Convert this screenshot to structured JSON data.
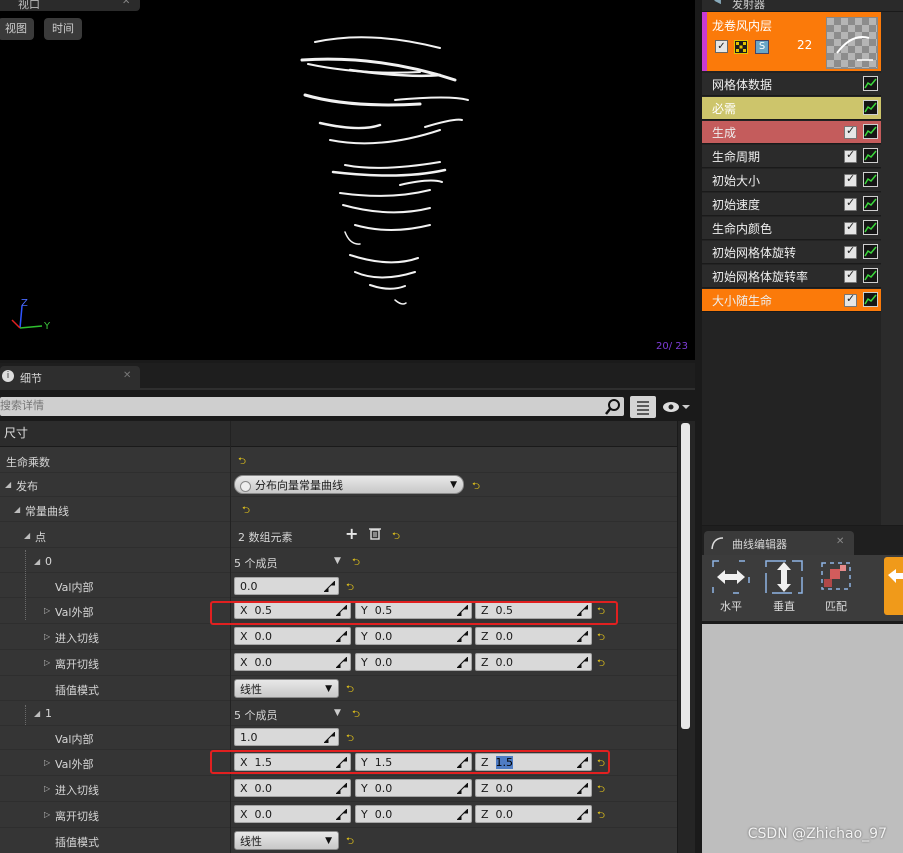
{
  "viewport": {
    "tab_label": "视口",
    "btn_view": "视图",
    "btn_time": "时间",
    "axis_z": "Z",
    "axis_y": "Y",
    "counter": "20/ 23"
  },
  "details": {
    "tab_label": "细节",
    "search_placeholder": "搜索详情",
    "section": "尺寸",
    "rows": {
      "life_mult": "生命乘数",
      "dist": "发布",
      "dist_value": "分布向量常量曲线",
      "const_curve": "常量曲线",
      "points": "点",
      "points_value": "2 数组元素",
      "idx0": "0",
      "idx0_value": "5 个成员",
      "in_val": "Val内部",
      "out_val": "Val外部",
      "arrive_tangent": "进入切线",
      "leave_tangent": "离开切线",
      "interp_mode": "插值模式",
      "interp_value": "线性",
      "idx1": "1",
      "idx1_value": "5 个成员"
    },
    "p0": {
      "in_val": "0.0",
      "out": {
        "x": "0.5",
        "y": "0.5",
        "z": "0.5"
      },
      "arrive": {
        "x": "0.0",
        "y": "0.0",
        "z": "0.0"
      },
      "leave": {
        "x": "0.0",
        "y": "0.0",
        "z": "0.0"
      }
    },
    "p1": {
      "in_val": "1.0",
      "out": {
        "x": "1.5",
        "y": "1.5",
        "z": "1.5"
      },
      "arrive": {
        "x": "0.0",
        "y": "0.0",
        "z": "0.0"
      },
      "leave": {
        "x": "0.0",
        "y": "0.0",
        "z": "0.0"
      }
    },
    "axis_labels": {
      "x": "X",
      "y": "Y",
      "z": "Z"
    }
  },
  "emitter": {
    "tab_label": "发射器",
    "name": "龙卷风内层",
    "count": "22",
    "modules": [
      {
        "label": "网格体数据",
        "color": "#2b2b2b",
        "checkbox": false
      },
      {
        "label": "必需",
        "color": "#cdc56b",
        "checkbox": false
      },
      {
        "label": "生成",
        "color": "#c45c5c",
        "checkbox": true
      },
      {
        "label": "生命周期",
        "color": "#2b2b2b",
        "checkbox": true
      },
      {
        "label": "初始大小",
        "color": "#2b2b2b",
        "checkbox": true
      },
      {
        "label": "初始速度",
        "color": "#2b2b2b",
        "checkbox": true
      },
      {
        "label": "生命内颜色",
        "color": "#2b2b2b",
        "checkbox": true
      },
      {
        "label": "初始网格体旋转",
        "color": "#2b2b2b",
        "checkbox": true
      },
      {
        "label": "初始网格体旋转率",
        "color": "#2b2b2b",
        "checkbox": true
      },
      {
        "label": "大小随生命",
        "color": "#fb7a0a",
        "checkbox": true
      }
    ]
  },
  "curve_editor": {
    "tab_label": "曲线编辑器",
    "btn_horizontal": "水平",
    "btn_vertical": "垂直",
    "btn_fit": "匹配"
  },
  "watermark": "CSDN @Zhichao_97"
}
